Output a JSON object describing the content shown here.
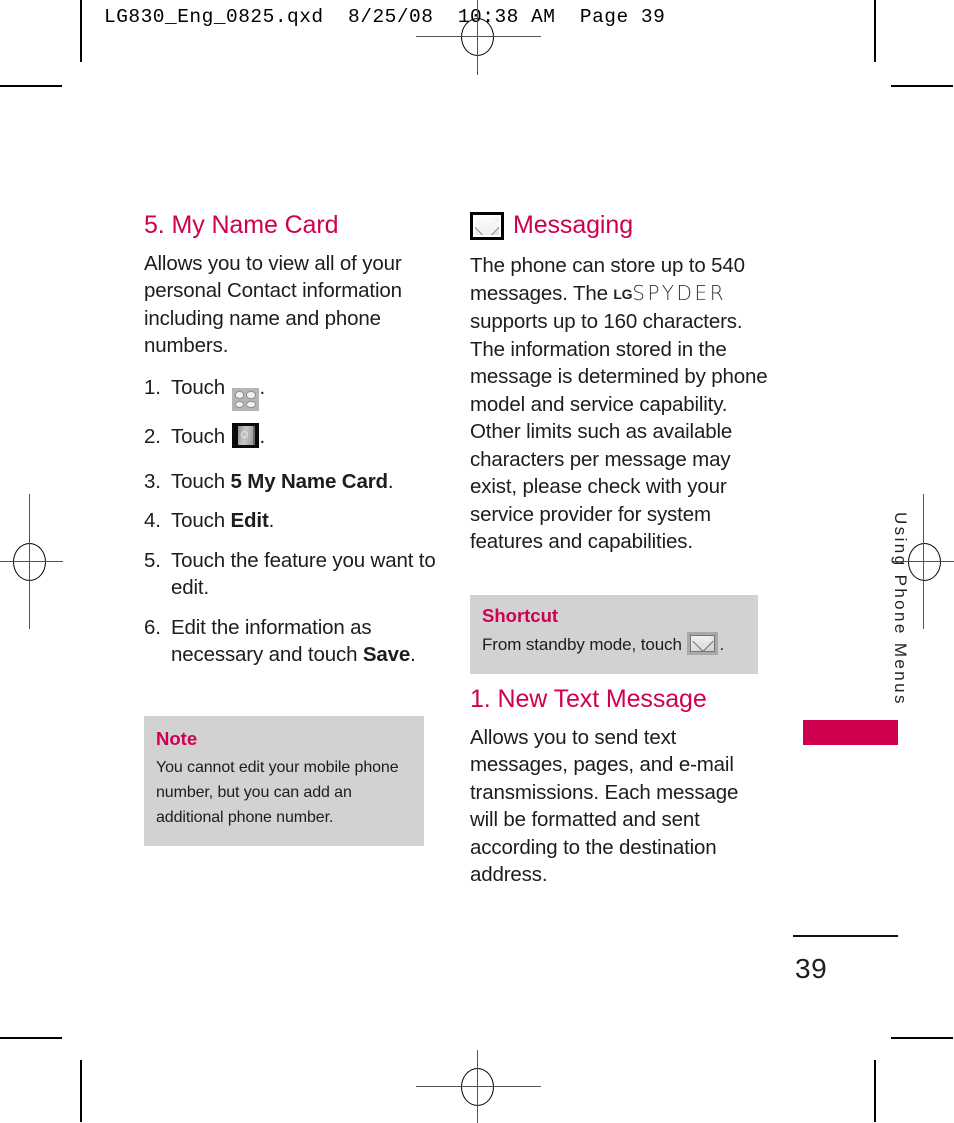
{
  "print_header": "LG830_Eng_0825.qxd  8/25/08  10:38 AM  Page 39",
  "left_column": {
    "heading": "5. My Name Card",
    "intro": "Allows you to view all of your personal Contact information including name and phone numbers.",
    "steps": [
      {
        "num": "1.",
        "pre": "Touch ",
        "icon": "menu-grid-icon",
        "post": "."
      },
      {
        "num": "2.",
        "pre": "Touch ",
        "icon": "contacts-book-icon",
        "post": "."
      },
      {
        "num": "3.",
        "pre": "Touch ",
        "bold": "5 My Name Card",
        "post": "."
      },
      {
        "num": "4.",
        "pre": "Touch ",
        "bold": "Edit",
        "post": "."
      },
      {
        "num": "5.",
        "pre": "Touch the feature you want to edit.",
        "bold": "",
        "post": ""
      },
      {
        "num": "6.",
        "pre": "Edit the information as necessary and touch ",
        "bold": "Save",
        "post": "."
      }
    ],
    "note": {
      "title": "Note",
      "body": "You cannot edit your mobile phone number, but you can add an additional phone number."
    }
  },
  "right_column": {
    "heading": "Messaging",
    "heading_icon": "envelope-icon",
    "intro_part1": "The phone can store up to 540 messages. The ",
    "brand_lg": "LG",
    "brand_model": "SPYDER",
    "intro_part2": " supports up to 160 characters. The information stored in the message is determined by phone model and service capability. Other limits such as available characters per message may exist, please check with your service provider for system features and capabilities.",
    "shortcut": {
      "title": "Shortcut",
      "body_pre": "From standby mode, touch ",
      "icon": "envelope-icon",
      "body_post": "."
    },
    "subsection": {
      "heading": "1. New Text Message",
      "body": "Allows you to send text messages, pages, and e-mail transmissions. Each message will be formatted and sent according to the destination address."
    }
  },
  "side_tab": {
    "label": "Using Phone Menus"
  },
  "folio": {
    "page_number": "39"
  },
  "colors": {
    "accent_magenta": "#D00050",
    "callout_grey": "#d2d2d2",
    "body_text": "#1d1d1d"
  }
}
